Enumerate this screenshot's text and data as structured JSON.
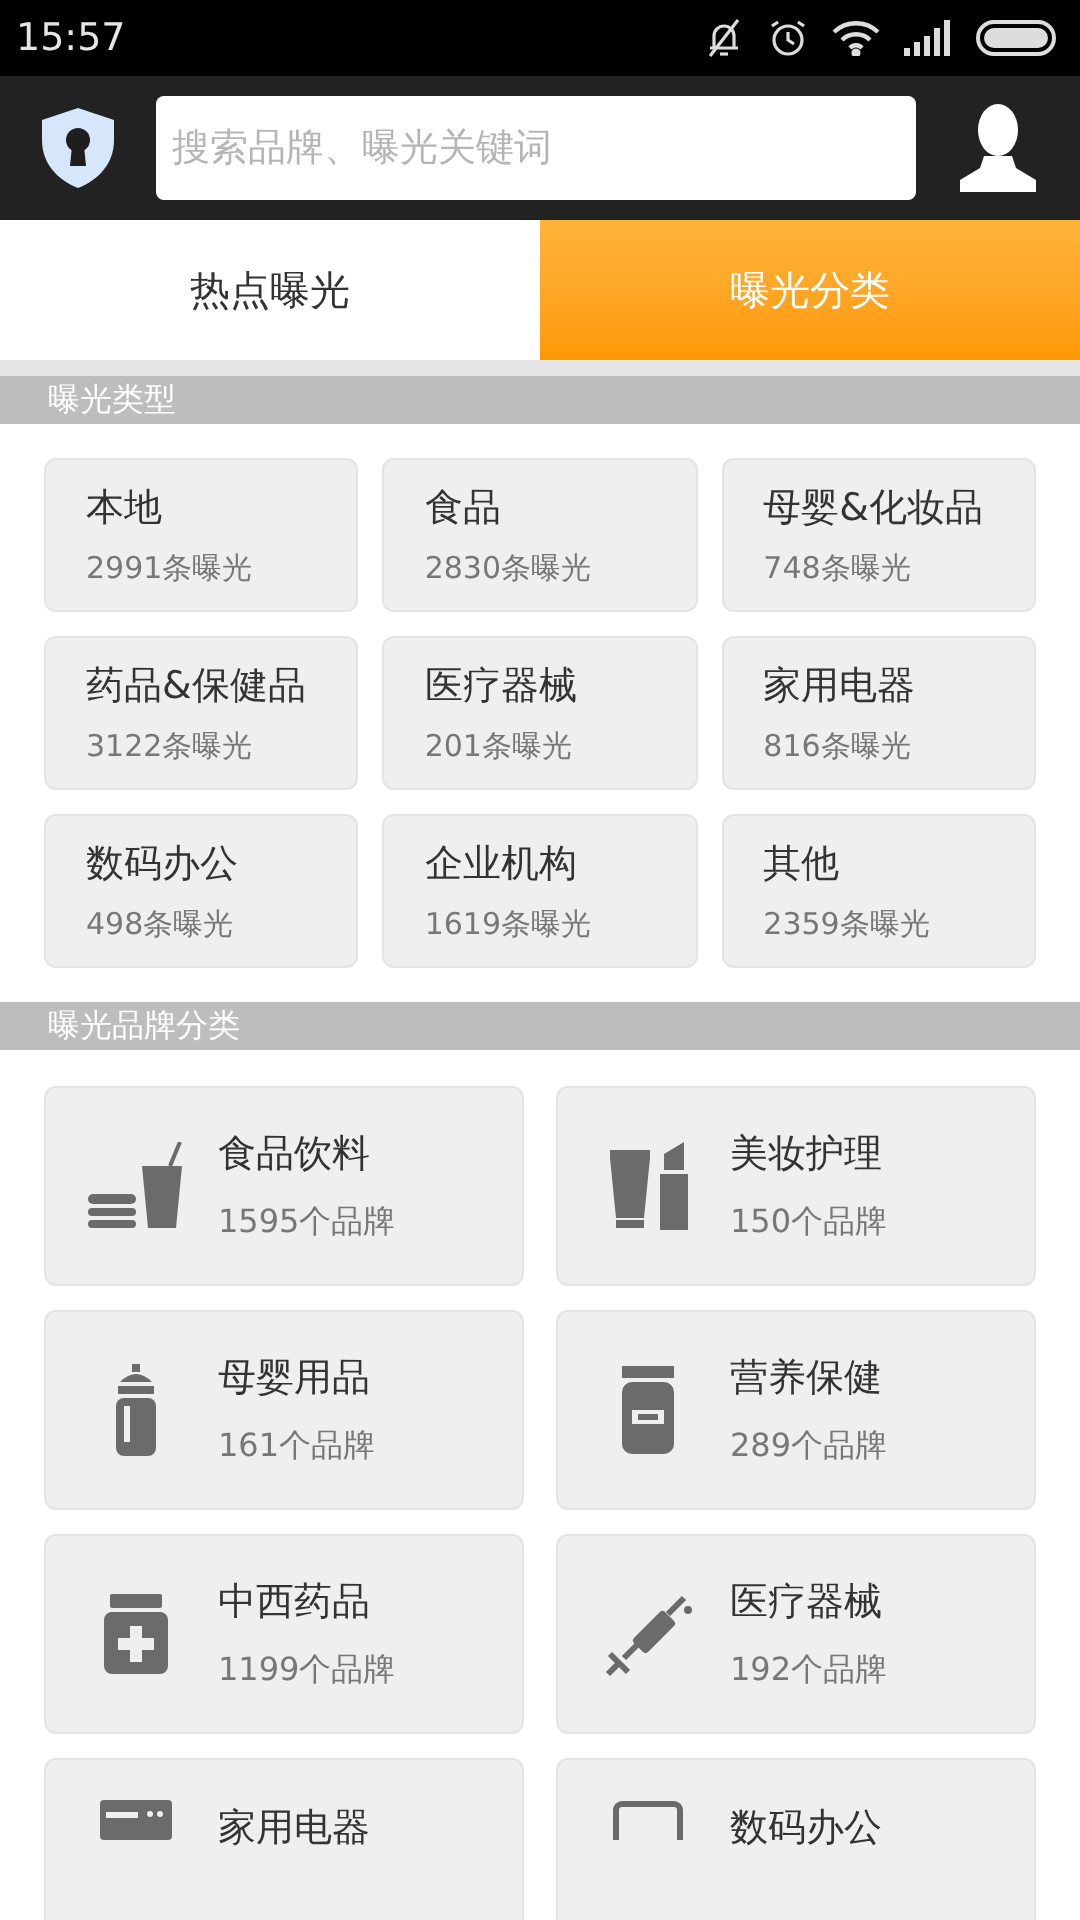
{
  "status_bar": {
    "time": "15:57"
  },
  "search": {
    "placeholder": "搜索品牌、曝光关键词"
  },
  "tabs": [
    {
      "label": "热点曝光",
      "selected": false
    },
    {
      "label": "曝光分类",
      "selected": true
    }
  ],
  "exposure_types": {
    "title": "曝光类型",
    "items": [
      {
        "name": "本地",
        "count": "2991条曝光"
      },
      {
        "name": "食品",
        "count": "2830条曝光"
      },
      {
        "name": "母婴&化妆品",
        "count": "748条曝光"
      },
      {
        "name": "药品&保健品",
        "count": "3122条曝光"
      },
      {
        "name": "医疗器械",
        "count": "201条曝光"
      },
      {
        "name": "家用电器",
        "count": "816条曝光"
      },
      {
        "name": "数码办公",
        "count": "498条曝光"
      },
      {
        "name": "企业机构",
        "count": "1619条曝光"
      },
      {
        "name": "其他",
        "count": "2359条曝光"
      }
    ]
  },
  "brand_categories": {
    "title": "曝光品牌分类",
    "items": [
      {
        "name": "食品饮料",
        "count": "1595个品牌"
      },
      {
        "name": "美妆护理",
        "count": "150个品牌"
      },
      {
        "name": "母婴用品",
        "count": "161个品牌"
      },
      {
        "name": "营养保健",
        "count": "289个品牌"
      },
      {
        "name": "中西药品",
        "count": "1199个品牌"
      },
      {
        "name": "医疗器械",
        "count": "192个品牌"
      },
      {
        "name": "家用电器"
      },
      {
        "name": "数码办公"
      }
    ]
  }
}
